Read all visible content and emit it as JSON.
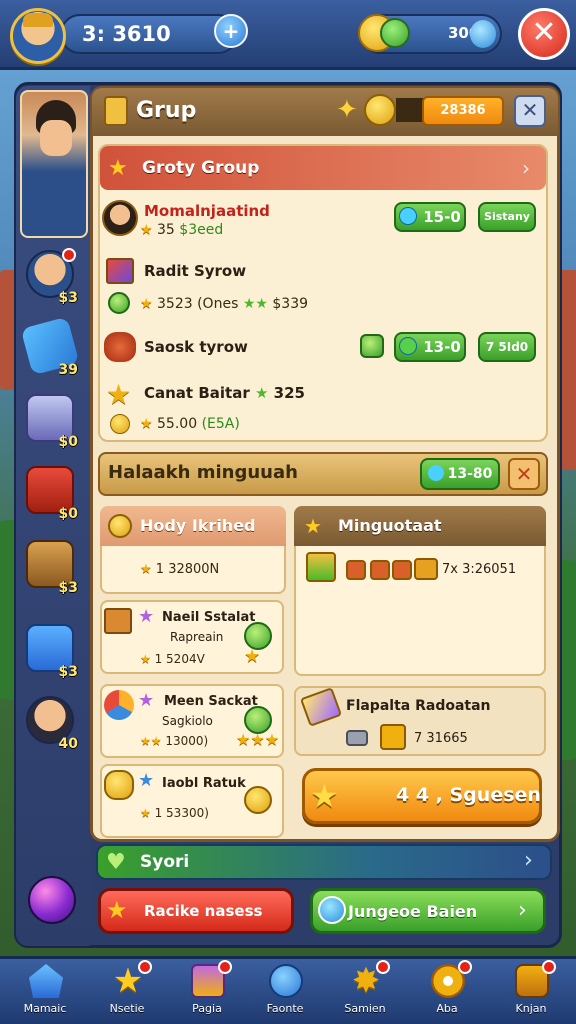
{
  "topbar": {
    "coins": "3: 3610",
    "plus": "+",
    "gems": "300",
    "close": "✕"
  },
  "rail": {
    "badges": [
      "$3",
      "39",
      "$0",
      "$0",
      "$3",
      "$3",
      "40"
    ]
  },
  "panel": {
    "title": "Grup",
    "amount": "28386",
    "close": "✕"
  },
  "group": {
    "title": "Groty Group",
    "rows": [
      {
        "name": "Momalnjaatind",
        "sub": "35",
        "sub_green": "$3eed",
        "pill1": "15-0",
        "pill2": "Sistany"
      },
      {
        "name": "Radit Syrow",
        "sub": "3523 (Ones",
        "sub_green": "$339",
        "pill1": "",
        "pill2": ""
      },
      {
        "name": "Saosk tyrow",
        "sub": "",
        "sub_green": "",
        "pill1": "13-0",
        "pill2": "7 5Id0"
      },
      {
        "name": "Canat Baitar",
        "name_green": "325",
        "sub": "55.00",
        "sub_green": "(E5A)",
        "pill1": "",
        "pill2": ""
      }
    ]
  },
  "halaakh": {
    "title": "Halaakh minguuah",
    "pill": "13-80",
    "close": "✕"
  },
  "hody": {
    "title": "Hody Ikrihed",
    "value": "1 32800N"
  },
  "items": [
    {
      "name": "Naeil Sstalat",
      "sub": "Rapreain",
      "value": "1 5204V"
    },
    {
      "name": "Meen Sackat",
      "sub": "Sagkiolo",
      "value": "13000)"
    },
    {
      "name": "Iaobl Ratuk",
      "sub": "",
      "value": "1 53300)"
    }
  ],
  "mingu": {
    "title": "Minguotaat",
    "value": "7x 3:26051"
  },
  "placa": {
    "title": "Flapalta Radoatan",
    "value": "7 31665"
  },
  "cta": {
    "label": "4 4 , Sguesen"
  },
  "syori": {
    "label": "Syori"
  },
  "buttons": {
    "red_label": "Racike nasess",
    "green_label": "Jungeoe Baien"
  },
  "nav": [
    {
      "label": "Mamaic"
    },
    {
      "label": "Nsetie"
    },
    {
      "label": "Pagia"
    },
    {
      "label": "Faonte"
    },
    {
      "label": "Samien"
    },
    {
      "label": "Aba"
    },
    {
      "label": "Knjan"
    }
  ],
  "colors": {
    "accent_blue": "#3b5fa0",
    "panel_bg": "#f4e6c6",
    "green": "#3aa02a",
    "red": "#d42a1a",
    "orange": "#f08a10"
  }
}
